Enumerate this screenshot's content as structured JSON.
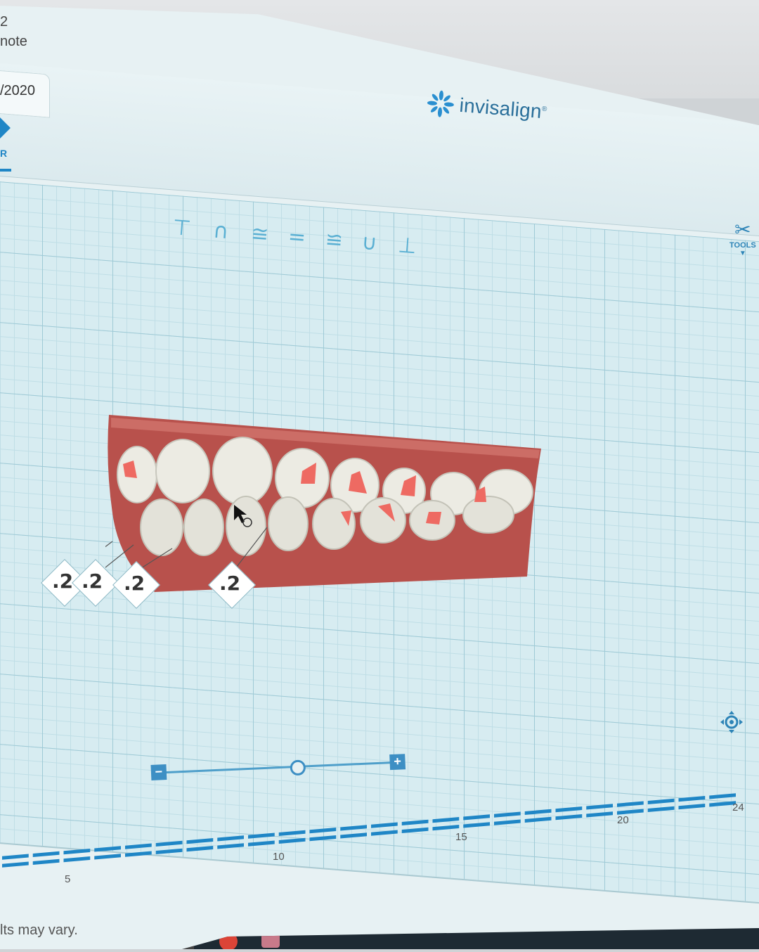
{
  "header": {
    "crumb_line1": "2",
    "crumb_line2": "note",
    "tab_date": "/2020",
    "nav_letter": "R"
  },
  "brand": {
    "name": "invisalign",
    "mark": "®",
    "accent_color": "#2a6f9a"
  },
  "view_toolbar": {
    "buttons": [
      {
        "icon": "top-view-icon",
        "glyph": "⊤"
      },
      {
        "icon": "upper-arch-icon",
        "glyph": "∩"
      },
      {
        "icon": "upper-occlusal-icon",
        "glyph": "≅"
      },
      {
        "icon": "front-view-icon",
        "glyph": "="
      },
      {
        "icon": "lower-occlusal-icon",
        "glyph": "≌"
      },
      {
        "icon": "lower-arch-icon",
        "glyph": "∪"
      },
      {
        "icon": "bottom-view-icon",
        "glyph": "⊥"
      }
    ]
  },
  "tools": {
    "icon": "tools-icon",
    "glyph": "✂",
    "label": "TOOLS",
    "caret": "▼"
  },
  "ipr_labels": [
    ".2",
    ".2",
    ".2",
    ".2"
  ],
  "zoom": {
    "minus": "−",
    "plus": "+",
    "level": 0.56
  },
  "timeline": {
    "stage_labels": [
      "5",
      "10",
      "15",
      "20",
      "24"
    ],
    "total_stages": 24,
    "accent_color": "#1f86c6"
  },
  "footer": {
    "disclaimer": "lts may vary."
  }
}
